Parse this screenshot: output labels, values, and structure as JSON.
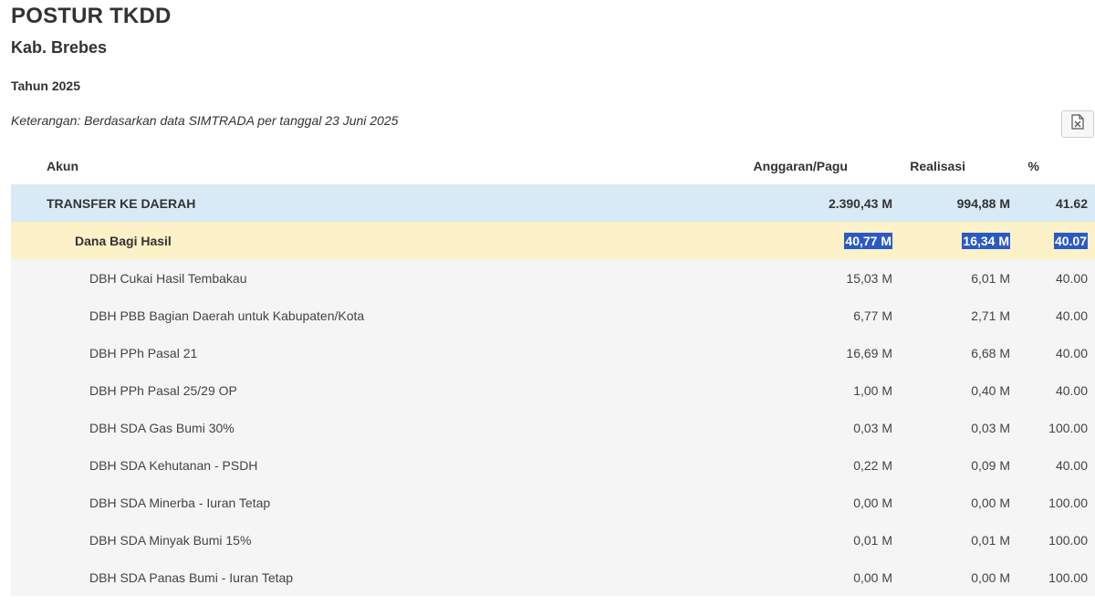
{
  "page": {
    "title": "POSTUR TKDD",
    "region": "Kab. Brebes",
    "year": "Tahun 2025",
    "note": "Keterangan: Berdasarkan data SIMTRADA per tanggal 23 Juni 2025",
    "export_icon": "excel-file-icon"
  },
  "table": {
    "headers": {
      "akun": "Akun",
      "pagu": "Anggaran/Pagu",
      "realisasi": "Realisasi",
      "pct": "%"
    },
    "rows": [
      {
        "akun": "TRANSFER KE DAERAH",
        "pagu": "2.390,43 M",
        "realisasi": "994,88 M",
        "pct": "41.62"
      },
      {
        "akun": "Dana Bagi Hasil",
        "pagu": "40,77 M",
        "realisasi": "16,34 M",
        "pct": "40.07"
      },
      {
        "akun": "DBH Cukai Hasil Tembakau",
        "pagu": "15,03 M",
        "realisasi": "6,01 M",
        "pct": "40.00"
      },
      {
        "akun": "DBH PBB Bagian Daerah untuk Kabupaten/Kota",
        "pagu": "6,77 M",
        "realisasi": "2,71 M",
        "pct": "40.00"
      },
      {
        "akun": "DBH PPh Pasal 21",
        "pagu": "16,69 M",
        "realisasi": "6,68 M",
        "pct": "40.00"
      },
      {
        "akun": "DBH PPh Pasal 25/29 OP",
        "pagu": "1,00 M",
        "realisasi": "0,40 M",
        "pct": "40.00"
      },
      {
        "akun": "DBH SDA Gas Bumi 30%",
        "pagu": "0,03 M",
        "realisasi": "0,03 M",
        "pct": "100.00"
      },
      {
        "akun": "DBH SDA Kehutanan - PSDH",
        "pagu": "0,22 M",
        "realisasi": "0,09 M",
        "pct": "40.00"
      },
      {
        "akun": "DBH SDA Minerba - Iuran Tetap",
        "pagu": "0,00 M",
        "realisasi": "0,00 M",
        "pct": "100.00"
      },
      {
        "akun": "DBH SDA Minyak Bumi 15%",
        "pagu": "0,01 M",
        "realisasi": "0,01 M",
        "pct": "100.00"
      },
      {
        "akun": "DBH SDA Panas Bumi - Iuran Tetap",
        "pagu": "0,00 M",
        "realisasi": "0,00 M",
        "pct": "100.00"
      }
    ]
  }
}
